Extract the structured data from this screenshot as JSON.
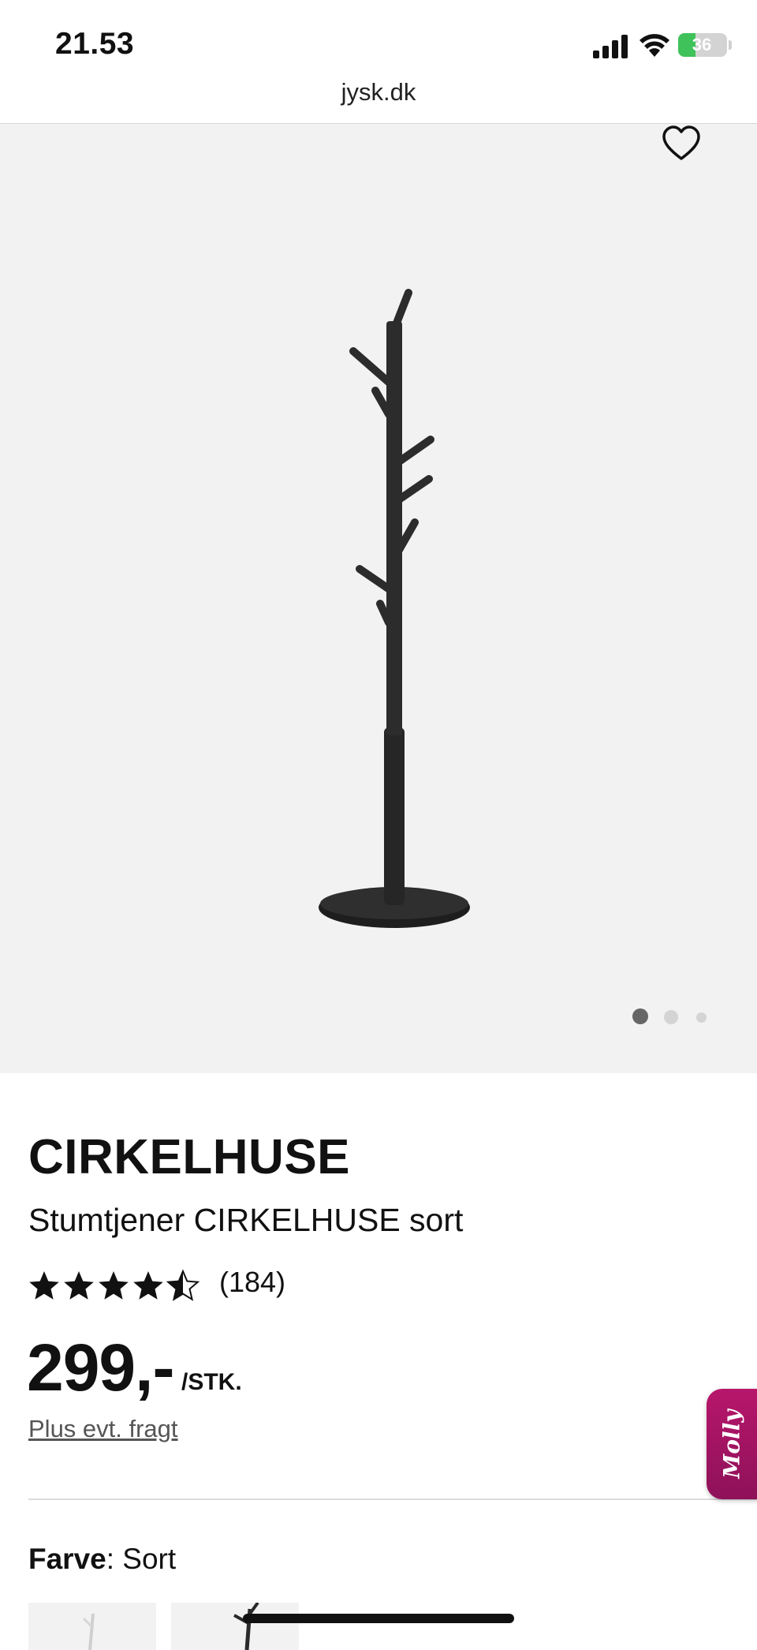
{
  "status_bar": {
    "time": "21.53",
    "battery": "36",
    "battery_level": 0.36,
    "icons": [
      "signal-icon",
      "wifi-icon",
      "battery-charging-icon"
    ]
  },
  "browser": {
    "url": "jysk.dk"
  },
  "gallery": {
    "active_index": 0,
    "count": 3,
    "favorite_icon": "heart-outline-icon"
  },
  "product": {
    "brand": "CIRKELHUSE",
    "name": "Stumtjener CIRKELHUSE sort",
    "rating": 4.5,
    "rating_max": 5,
    "rating_count": "(184)",
    "price": "299,-",
    "price_unit": "/STK.",
    "freight_link": "Plus evt. fragt",
    "color_label": "Farve",
    "color_separator": ": ",
    "color_value": "Sort"
  },
  "chat": {
    "label": "Molly"
  },
  "colors": {
    "accent_pink": "#b7166b",
    "battery_green": "#3fc259",
    "gallery_bg": "#f2f2f2",
    "text": "#111111"
  }
}
